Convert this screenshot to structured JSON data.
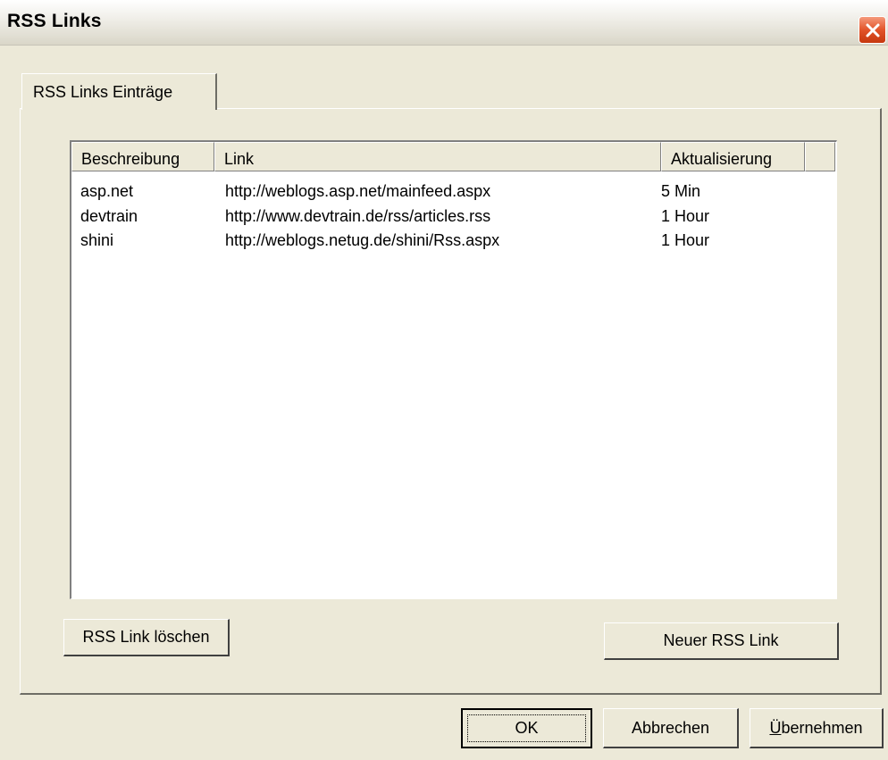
{
  "window": {
    "title": "RSS Links"
  },
  "tabs": [
    {
      "label": "RSS Links Einträge"
    }
  ],
  "listview": {
    "columns": [
      "Beschreibung",
      "Link",
      "Aktualisierung"
    ],
    "rows": [
      {
        "beschreibung": "asp.net",
        "link": "http://weblogs.asp.net/mainfeed.aspx",
        "aktualisierung": "5 Min"
      },
      {
        "beschreibung": "devtrain",
        "link": "http://www.devtrain.de/rss/articles.rss",
        "aktualisierung": "1 Hour"
      },
      {
        "beschreibung": "shini",
        "link": "http://weblogs.netug.de/shini/Rss.aspx",
        "aktualisierung": "1 Hour"
      }
    ]
  },
  "buttons": {
    "delete": "RSS Link löschen",
    "new": "Neuer RSS Link",
    "ok": "OK",
    "cancel": "Abbrechen",
    "apply_mnemonic": "Ü",
    "apply_rest": "bernehmen"
  },
  "icons": {
    "close": "close-icon"
  },
  "colors": {
    "background": "#ece9d8",
    "close_button": "#e2542a"
  }
}
